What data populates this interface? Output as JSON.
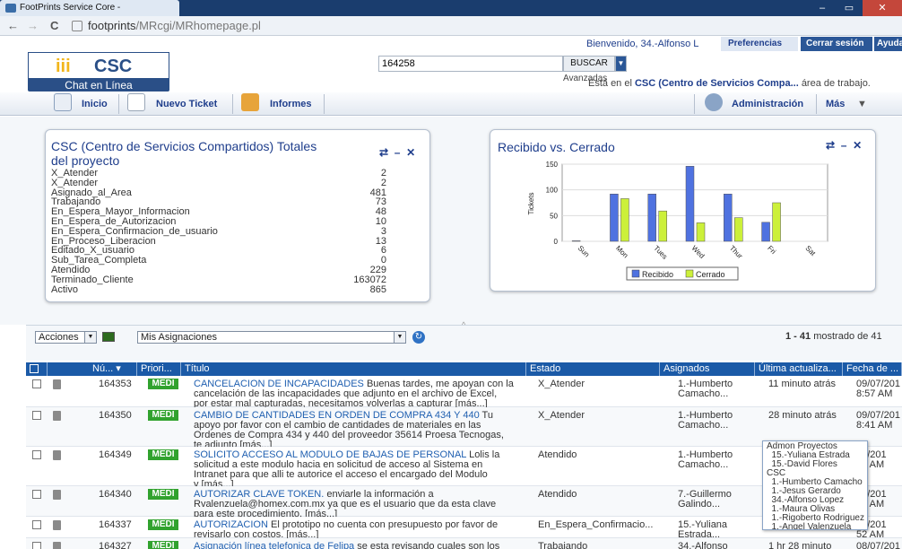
{
  "browser": {
    "tab_title": "FootPrints Service Core - ",
    "url_prefix": "footprints",
    "url_rest": "/MRcgi/MRhomepage.pl",
    "close_symbol": "✕",
    "min_symbol": "–",
    "max_symbol": "▭",
    "back": "←",
    "forward": "→",
    "reload": "C"
  },
  "header": {
    "welcome": "Bienvenido, 34.-Alfonso L",
    "preferences": "Preferencias",
    "logout": "Cerrar sesión",
    "help": "Ayuda",
    "logo_mark": "iii",
    "logo_text": "CSC",
    "logo_sub": "Chat en Línea",
    "search_value": "164258",
    "search_button": "BUSCAR",
    "advanced": "Avanzadas",
    "workspace_prefix": "Está en el",
    "workspace_name": "CSC (Centro de Servicios Compa...",
    "workspace_suffix": "área de trabajo."
  },
  "navbar": {
    "home": "Inicio",
    "new_ticket": "Nuevo Ticket",
    "reports": "Informes",
    "admin": "Administración",
    "more": "Más"
  },
  "totals_widget": {
    "title_line1": "CSC (Centro de Servicios Compartidos) Totales",
    "title_line2": "del proyecto",
    "rows": [
      {
        "label": "X_Atender",
        "value": "2"
      },
      {
        "label": "X_Atender",
        "value": "2"
      },
      {
        "label": "Asignado_al_Area",
        "value": "481"
      },
      {
        "label": "Trabajando",
        "value": "73"
      },
      {
        "label": "En_Espera_Mayor_Informacion",
        "value": "48"
      },
      {
        "label": "En_Espera_de_Autorizacion",
        "value": "10"
      },
      {
        "label": "En_Espera_Confirmacion_de_usuario",
        "value": "3"
      },
      {
        "label": "En_Proceso_Liberacion",
        "value": "13"
      },
      {
        "label": "Editado_X_usuario",
        "value": "6"
      },
      {
        "label": "Sub_Tarea_Completa",
        "value": "0"
      },
      {
        "label": "Atendido",
        "value": "229"
      },
      {
        "label": "Terminado_Cliente",
        "value": "163072"
      },
      {
        "label": "Activo",
        "value": "865"
      }
    ]
  },
  "chart_widget": {
    "title": "Recibido vs. Cerrado"
  },
  "chart_data": {
    "type": "bar",
    "title": "Recibido vs. Cerrado",
    "ylabel": "Tickets",
    "xlabel": "",
    "categories": [
      "Sun",
      "Mon",
      "Tues",
      "Wed",
      "Thur",
      "Fri",
      "Sat"
    ],
    "ylim": [
      0,
      150
    ],
    "yticks": [
      0,
      50,
      100,
      150
    ],
    "series": [
      {
        "name": "Recibido",
        "color": "#4f72e0",
        "values": [
          1,
          92,
          92,
          146,
          92,
          37,
          0
        ]
      },
      {
        "name": "Cerrado",
        "color": "#ccf03a",
        "values": [
          0,
          83,
          59,
          36,
          46,
          75,
          0
        ]
      }
    ],
    "legend": "bottom-center",
    "grid": true
  },
  "list_controls": {
    "actions": "Acciones",
    "view": "Mis Asignaciones",
    "pager_range": "1 - 41",
    "pager_text": "mostrado de 41"
  },
  "table": {
    "headers": [
      "Nú...",
      "Priori...",
      "Título",
      "Estado",
      "Asignados",
      "Última actualiza...",
      "Fecha de ..."
    ],
    "rows": [
      {
        "num": "164353",
        "prio": "MEDI",
        "link": "CANCELACION DE INCAPACIDADES",
        "line1": " Buenas tardes, me apoyan con la",
        "line2": "cancelación de las incapacidades que adjunto en el archivo de Excel,",
        "line3": "por estar mal capturadas, necesitamos volverlas a capturar [más...]",
        "line4": "",
        "estado": "X_Atender",
        "asig1": "1.-Humberto",
        "asig2": "Camacho...",
        "updated": "11 minuto atrás",
        "date1": "09/07/201",
        "date2": "8:57 AM"
      },
      {
        "num": "164350",
        "prio": "MEDI",
        "link": "CAMBIO DE CANTIDADES EN ORDEN DE COMPRA 434 Y 440",
        "line1": " Tu",
        "line2": "apoyo por favor con el cambio de cantidades de materiales en las",
        "line3": "Ordenes de Compra 434 y 440 del proveedor 35614 Proesa Tecnogas,",
        "line4": "te adjunto [más...]",
        "estado": "X_Atender",
        "asig1": "1.-Humberto",
        "asig2": "Camacho...",
        "updated": "28 minuto atrás",
        "date1": "09/07/201",
        "date2": "8:41 AM"
      },
      {
        "num": "164349",
        "prio": "MEDI",
        "link": "SOLICITO ACCESO AL MODULO DE BAJAS DE PERSONAL",
        "line1": " Lolis la",
        "line2": "solicitud a este modulo hacia en solicitud de acceso al Sistema en",
        "line3": "Intranet para que alli te autorice el acceso el encargado del Modulo",
        "line4": "y [más...]",
        "estado": "Atendido",
        "asig1": "1.-Humberto",
        "asig2": "Camacho...",
        "updated": "",
        "date1": "07/201",
        "date2": "32 AM"
      },
      {
        "num": "164340",
        "prio": "MEDI",
        "link": "AUTORIZAR CLAVE TOKEN.",
        "line1": " enviarle la información a",
        "line2": "Rvalenzuela@homex.com.mx ya que es el usuario que da esta clave",
        "line3": "para este procedimiento. [más...]",
        "line4": "",
        "estado": "Atendido",
        "asig1": "7.-Guillermo",
        "asig2": "Galindo...",
        "updated": "",
        "date1": "07/201",
        "date2": "07 AM"
      },
      {
        "num": "164337",
        "prio": "MEDI",
        "link": "AUTORIZACION",
        "line1": " El prototipo no cuenta con presupuesto por favor de",
        "line2": "revisarlo con costos. [más...]",
        "line3": "",
        "line4": "",
        "estado": "En_Espera_Confirmacio...",
        "asig1": "15.-Yuliana",
        "asig2": "Estrada...",
        "updated": "atrás",
        "date1": "07/201",
        "date2": "52 AM"
      },
      {
        "num": "164327",
        "prio": "MEDI",
        "link": "Asignación línea telefonica de Felipa",
        "line1": " se esta revisando cuales son los",
        "line2": "",
        "line3": "",
        "line4": "",
        "estado": "Trabajando",
        "asig1": "34.-Alfonso",
        "asig2": "",
        "updated": "1 hr 28 minuto",
        "date1": "08/07/201",
        "date2": ""
      }
    ]
  },
  "assignee_popup": [
    "Admon Proyectos",
    "  15.-Yuliana Estrada",
    "  15.-David Flores",
    "CSC",
    "  1.-Humberto Camacho",
    "  1.-Jesus Gerardo",
    "  34.-Alfonso Lopez",
    "  1.-Maura Olivas",
    "  1.-Rigoberto Rodriguez",
    "  1.-Angel Valenzuela"
  ]
}
